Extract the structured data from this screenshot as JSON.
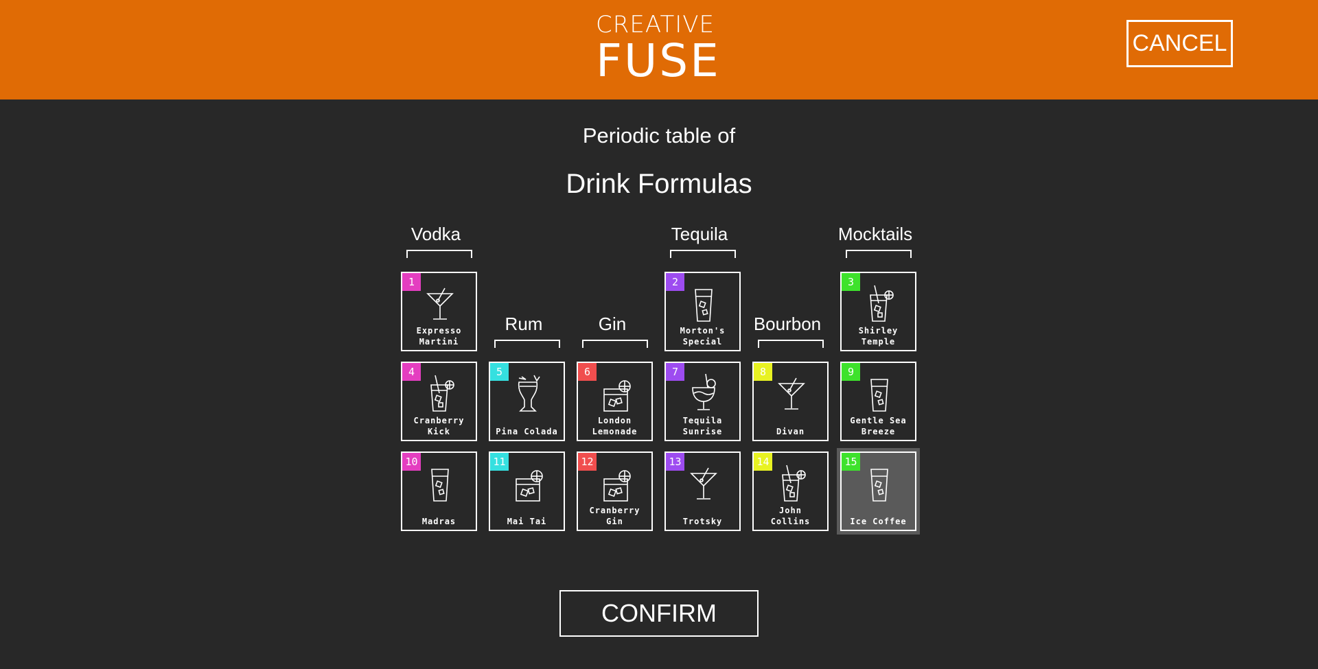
{
  "header": {
    "logo_top": "CREATIVE",
    "logo_bottom": "FUSE",
    "cancel_label": "CANCEL"
  },
  "title": {
    "line1": "Periodic table of",
    "line2": "Drink Formulas"
  },
  "groups": [
    "Vodka",
    "Rum",
    "Gin",
    "Tequila",
    "Bourbon",
    "Mocktails"
  ],
  "colors": {
    "header": "#e06b05",
    "background": "#282828",
    "magenta": "#e43ec0",
    "cyan": "#35e0e0",
    "red": "#f04e4e",
    "purple": "#9d4cf0",
    "yellow": "#e8f222",
    "green": "#3ee22c"
  },
  "drinks": [
    {
      "num": "1",
      "line1": "Expresso",
      "line2": "Martini",
      "color": "#e43ec0",
      "icon": "martini-glass-icon"
    },
    {
      "num": "2",
      "line1": "Morton's",
      "line2": "Special",
      "color": "#9d4cf0",
      "icon": "tall-glass-icon"
    },
    {
      "num": "3",
      "line1": "Shirley",
      "line2": "Temple",
      "color": "#3ee22c",
      "icon": "highball-glass-icon"
    },
    {
      "num": "4",
      "line1": "Cranberry",
      "line2": "Kick",
      "color": "#e43ec0",
      "icon": "highball-glass-icon"
    },
    {
      "num": "5",
      "line1": "",
      "line2": "Pina Colada",
      "color": "#35e0e0",
      "icon": "hurricane-glass-icon"
    },
    {
      "num": "6",
      "line1": "London",
      "line2": "Lemonade",
      "color": "#f04e4e",
      "icon": "rocks-glass-icon"
    },
    {
      "num": "7",
      "line1": "Tequila",
      "line2": "Sunrise",
      "color": "#9d4cf0",
      "icon": "goblet-glass-icon"
    },
    {
      "num": "8",
      "line1": "",
      "line2": "Divan",
      "color": "#e8f222",
      "icon": "martini-glass-icon"
    },
    {
      "num": "9",
      "line1": "Gentle Sea",
      "line2": "Breeze",
      "color": "#3ee22c",
      "icon": "tall-glass-icon"
    },
    {
      "num": "10",
      "line1": "",
      "line2": "Madras",
      "color": "#e43ec0",
      "icon": "tall-glass-icon"
    },
    {
      "num": "11",
      "line1": "",
      "line2": "Mai Tai",
      "color": "#35e0e0",
      "icon": "rocks-glass-icon"
    },
    {
      "num": "12",
      "line1": "Cranberry",
      "line2": "Gin",
      "color": "#f04e4e",
      "icon": "rocks-glass-icon"
    },
    {
      "num": "13",
      "line1": "",
      "line2": "Trotsky",
      "color": "#9d4cf0",
      "icon": "martini-glass-icon"
    },
    {
      "num": "14",
      "line1": "John",
      "line2": "Collins",
      "color": "#e8f222",
      "icon": "highball-glass-icon"
    },
    {
      "num": "15",
      "line1": "",
      "line2": "Ice Coffee",
      "color": "#3ee22c",
      "icon": "tall-glass-icon",
      "selected": true
    }
  ],
  "confirm_label": "CONFIRM"
}
